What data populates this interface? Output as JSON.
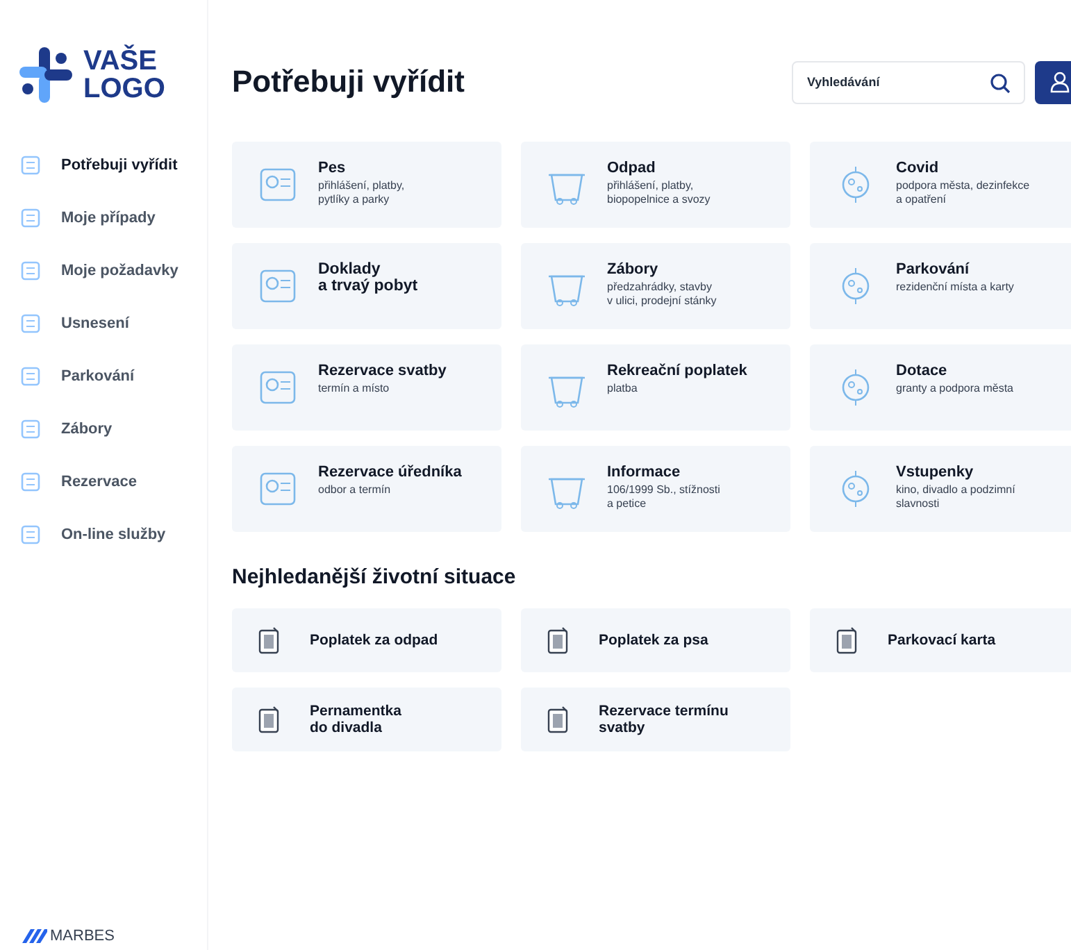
{
  "logo": {
    "line_1": "VAŠE",
    "line_2": "LOGO"
  },
  "sidebar": {
    "items": [
      {
        "label": "Potřebuji vyřídit",
        "selected": true
      },
      {
        "label": "Moje případy",
        "selected": false
      },
      {
        "label": "Moje požadavky",
        "selected": false
      },
      {
        "label": "Usnesení",
        "selected": false
      },
      {
        "label": "Parkování",
        "selected": false
      },
      {
        "label": "Zábory",
        "selected": false
      },
      {
        "label": "Rezervace",
        "selected": false
      },
      {
        "label": "On-line služby",
        "selected": false
      }
    ]
  },
  "footer_brand": "MARBES",
  "title": "Potřebuji vyřídit",
  "search": {
    "placeholder": "Vyhledávání"
  },
  "services": [
    {
      "title": "Pes",
      "subtitle": "přihlášení, platby,\npytlíky a parky"
    },
    {
      "title": "Odpad",
      "subtitle": "přihlášení, platby,\nbiopopelnice a svozy"
    },
    {
      "title": "Covid",
      "subtitle": "podpora města, dezinfekce\na opatření"
    },
    {
      "title": "Doklady\na trvaý pobyt"
    },
    {
      "title": "Zábory",
      "subtitle": "předzahrádky, stavby\nv ulici, prodejní stánky"
    },
    {
      "title": "Parkování",
      "subtitle": "rezidenční místa a karty"
    },
    {
      "title": "Rezervace svatby",
      "subtitle": "termín a místo"
    },
    {
      "title": "Rekreační poplatek",
      "subtitle": "platba"
    },
    {
      "title": "Dotace",
      "subtitle": "granty a podpora města"
    },
    {
      "title": "Rezervace úředníka",
      "subtitle": "odbor a termín"
    },
    {
      "title": "Informace",
      "subtitle": "106/1999 Sb., stížnosti\na petice"
    },
    {
      "title": "Vstupenky",
      "subtitle": "kino, divadlo a podzimní\nslavnosti"
    }
  ],
  "popular": {
    "heading": "Nejhledanější životní situace",
    "items": [
      {
        "label": "Poplatek za odpad"
      },
      {
        "label": "Poplatek za psa"
      },
      {
        "label": "Parkovací karta"
      },
      {
        "label": "Pernamentka\ndo divadla"
      },
      {
        "label": "Rezervace termínu\nsvatby"
      }
    ]
  }
}
